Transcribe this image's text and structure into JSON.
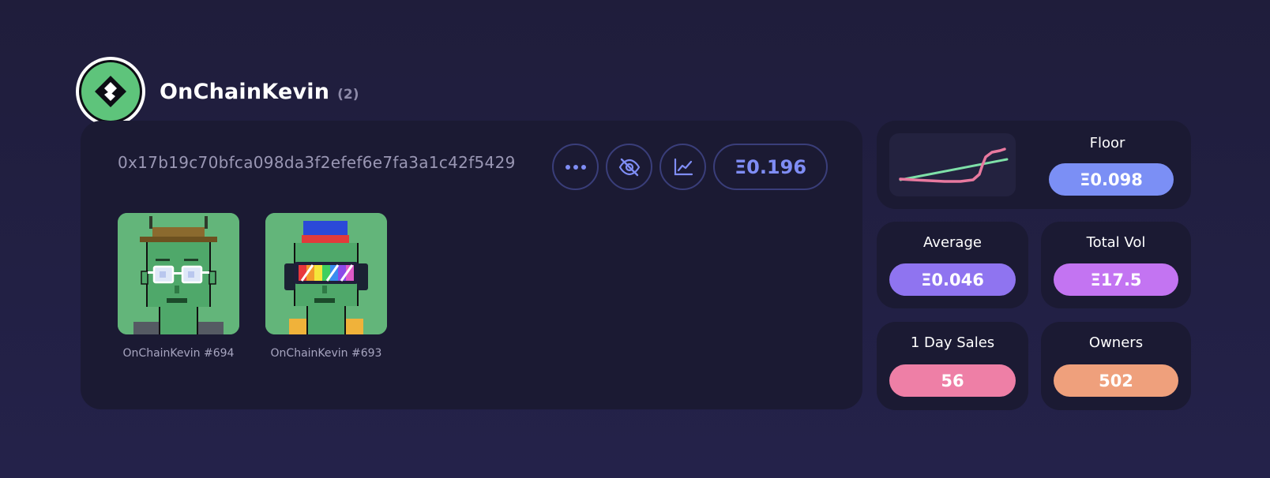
{
  "collection": {
    "name": "OnChainKevin",
    "count": "(2)"
  },
  "wallet": {
    "address": "0x17b19c70bfca098da3f2efef6e7fa3a1c42f5429",
    "total_value": "Ξ0.196"
  },
  "actions": [
    {
      "icon": "more-icon"
    },
    {
      "icon": "eye-off-icon"
    },
    {
      "icon": "chart-icon"
    }
  ],
  "nfts": [
    {
      "caption": "OnChainKevin #694"
    },
    {
      "caption": "OnChainKevin #693"
    }
  ],
  "stats": {
    "floor": {
      "label": "Floor",
      "value": "Ξ0.098",
      "color": "#7b8ff5"
    },
    "average": {
      "label": "Average",
      "value": "Ξ0.046",
      "color": "#8f74f0"
    },
    "total_vol": {
      "label": "Total Vol",
      "value": "Ξ17.5",
      "color": "#c374f2"
    },
    "day_sales": {
      "label": "1 Day Sales",
      "value": "56",
      "color": "#ee7fa6"
    },
    "owners": {
      "label": "Owners",
      "value": "502",
      "color": "#efa07c"
    }
  },
  "colors": {
    "accent": "#7f8df5",
    "card": "#1b1a33",
    "background": "#1f1d3b",
    "logo_green": "#5ec47b",
    "sparkline_trend": "#7ee0a8",
    "sparkline_price": "#e8799f"
  }
}
